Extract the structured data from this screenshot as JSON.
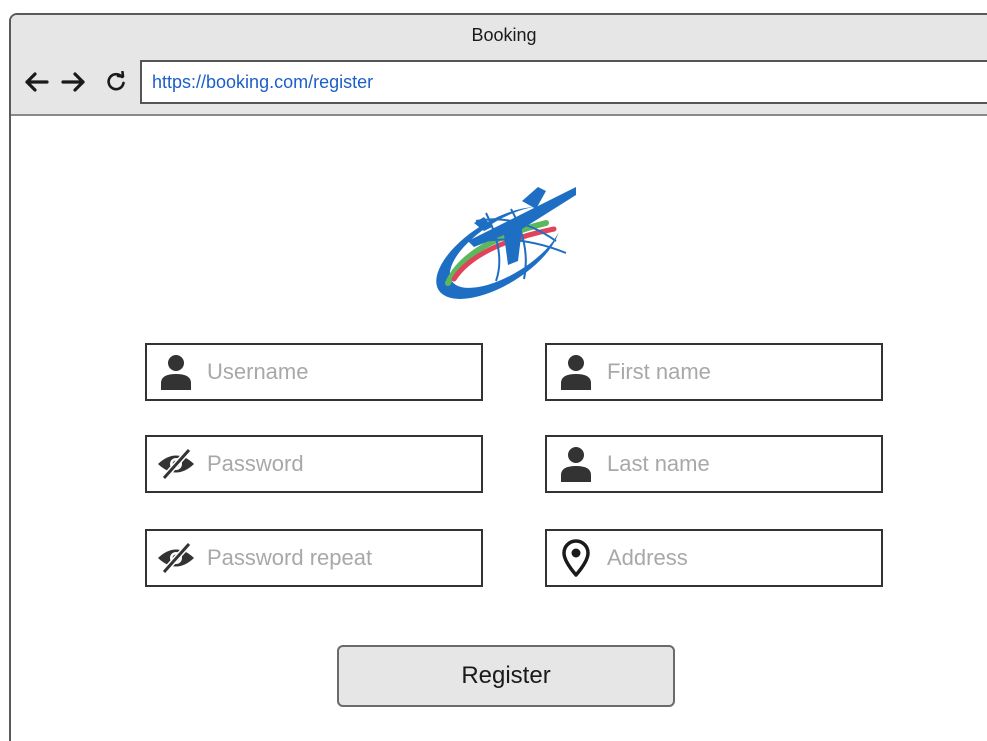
{
  "window": {
    "title": "Booking",
    "url": "https://booking.com/register"
  },
  "nav": {
    "back_icon": "arrow-left-icon",
    "forward_icon": "arrow-right-icon",
    "reload_icon": "reload-icon"
  },
  "logo": {
    "icon": "airplane-globe-logo"
  },
  "form": {
    "username": {
      "placeholder": "Username",
      "icon": "user-icon"
    },
    "first_name": {
      "placeholder": "First name",
      "icon": "user-icon"
    },
    "password": {
      "placeholder": "Password",
      "icon": "eye-slash-icon"
    },
    "last_name": {
      "placeholder": "Last name",
      "icon": "user-icon"
    },
    "password_repeat": {
      "placeholder": "Password repeat",
      "icon": "eye-slash-icon"
    },
    "address": {
      "placeholder": "Address",
      "icon": "map-pin-icon"
    },
    "register_label": "Register"
  },
  "colors": {
    "url_text": "#1c5fc9",
    "placeholder": "#a8a8a8",
    "icon": "#333333",
    "logo_blue": "#1e6fc4",
    "logo_red": "#e0435a",
    "logo_green": "#5cb85c"
  }
}
